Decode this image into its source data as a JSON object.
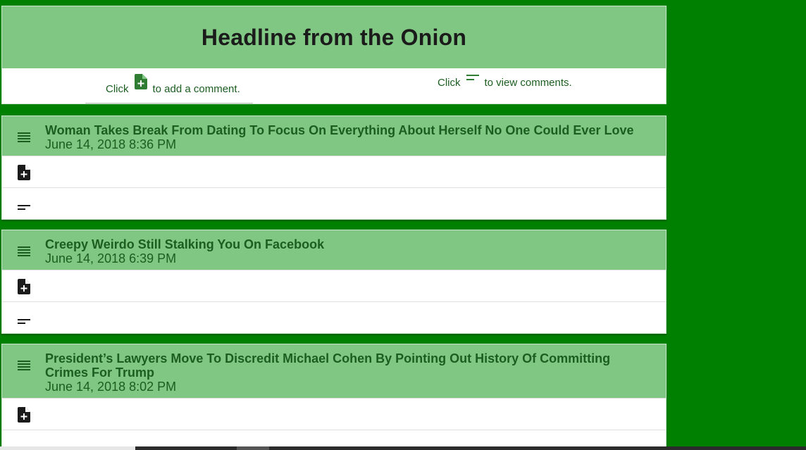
{
  "header": {
    "title": "Headline from the Onion",
    "add_hint": {
      "prefix": "Click",
      "suffix": "to add a comment.",
      "icon": "note-add-icon"
    },
    "view_hint": {
      "prefix": "Click",
      "suffix": "to view comments.",
      "icon": "short-text-icon"
    }
  },
  "articles": [
    {
      "title": "Woman Takes Break From Dating To Focus On Everything About Herself No One Could Ever Love",
      "date": "June 14, 2018 8:36 PM"
    },
    {
      "title": "Creepy Weirdo Still Stalking You On Facebook",
      "date": "June 14, 2018 6:39 PM"
    },
    {
      "title": "President’s Lawyers Move To Discredit Michael Cohen By Pointing Out History Of Committing Crimes For Trump",
      "date": "June 14, 2018 8:02 PM"
    }
  ],
  "colors": {
    "background": "#008000",
    "header_bar": "#81c784",
    "text_green": "#1b5e20",
    "icon_green": "#2e7d32"
  }
}
